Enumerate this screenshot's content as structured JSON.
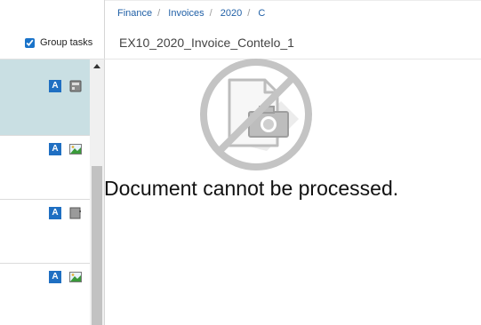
{
  "left_panel": {
    "group_tasks_label": "Group tasks",
    "group_tasks_checked": true,
    "tasks": [
      {
        "badge": "A",
        "thumb_icon": "document-page-icon",
        "selected": true
      },
      {
        "badge": "A",
        "thumb_icon": "image-icon",
        "selected": false
      },
      {
        "badge": "A",
        "thumb_icon": "document-page-icon",
        "selected": false
      },
      {
        "badge": "A",
        "thumb_icon": "image-icon",
        "selected": false
      }
    ]
  },
  "breadcrumb": [
    "Finance",
    "Invoices",
    "2020",
    "C"
  ],
  "document": {
    "title": "EX10_2020_Invoice_Contelo_1",
    "error_message": "Document cannot be processed.",
    "error_icon": "no-document-icon"
  },
  "colors": {
    "selected_row": "#c9dfe3",
    "badge": "#1f6fc2",
    "link": "#1f5fa6"
  }
}
